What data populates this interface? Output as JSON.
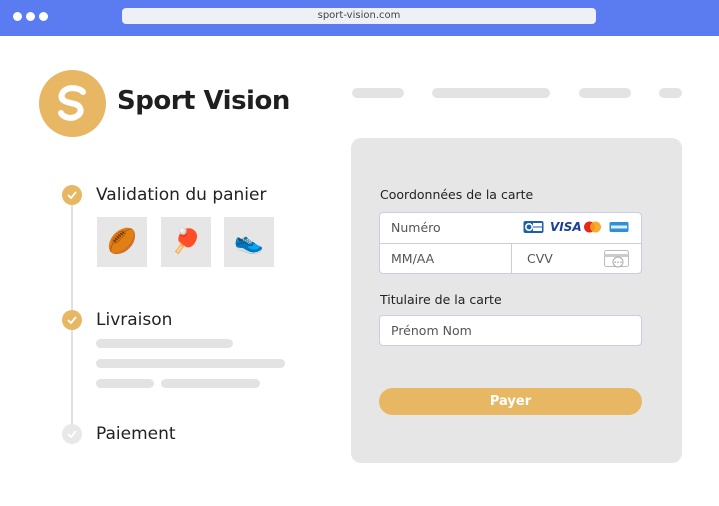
{
  "browser": {
    "url": "sport-vision.com"
  },
  "brand": {
    "name": "Sport Vision"
  },
  "colors": {
    "accent": "#e8b764",
    "chrome": "#5b7cf0",
    "panel": "#e6e6e6"
  },
  "steps": [
    {
      "label": "Validation du panier",
      "status": "done"
    },
    {
      "label": "Livraison",
      "status": "done"
    },
    {
      "label": "Paiement",
      "status": "pending"
    }
  ],
  "cart_items": [
    {
      "icon": "rugby-ball-icon",
      "glyph": "🏉"
    },
    {
      "icon": "ping-pong-paddle-icon",
      "glyph": "🏓"
    },
    {
      "icon": "sneaker-icon",
      "glyph": "👟"
    }
  ],
  "payment": {
    "card_section_title": "Coordonnées de la carte",
    "card_number_placeholder": "Numéro",
    "expiry_placeholder": "MM/AA",
    "cvv_placeholder": "CVV",
    "holder_section_title": "Titulaire de la carte",
    "holder_placeholder": "Prénom Nom",
    "card_brands": [
      "CB",
      "VISA",
      "mastercard",
      "amex"
    ],
    "pay_label": "Payer"
  }
}
